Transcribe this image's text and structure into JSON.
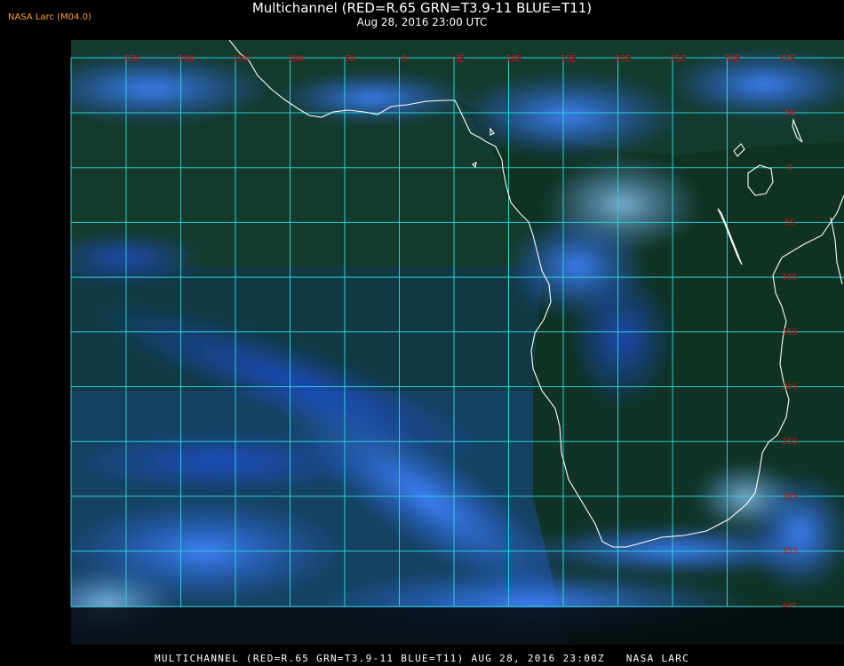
{
  "header": {
    "source": "NASA Larc (M04.0)",
    "title": "Multichannel (RED=R.65 GRN=T3.9-11 BLUE=T11)",
    "datetime": "Aug 28, 2016 23:00 UTC"
  },
  "footer": {
    "caption": "MULTICHANNEL (RED=R.65 GRN=T3.9-11 BLUE=T11) AUG 28, 2016 23:00Z   NASA LARC"
  },
  "map": {
    "lon_labels": [
      "25W",
      "20W",
      "15W",
      "10W",
      "5W",
      "0",
      "5E",
      "10E",
      "15E",
      "20E",
      "25E",
      "30E",
      "35E"
    ],
    "lat_labels": [
      "5N",
      "0",
      "5S",
      "10S",
      "15S",
      "20S",
      "25S",
      "30S",
      "35S",
      "40S"
    ],
    "colors": {
      "grid": "#2ad0d8",
      "coastline": "#ffffff",
      "labels": "#c41414",
      "ocean": "#0d3a44",
      "land": "#11361f",
      "cloud": "#2a6aff"
    }
  }
}
